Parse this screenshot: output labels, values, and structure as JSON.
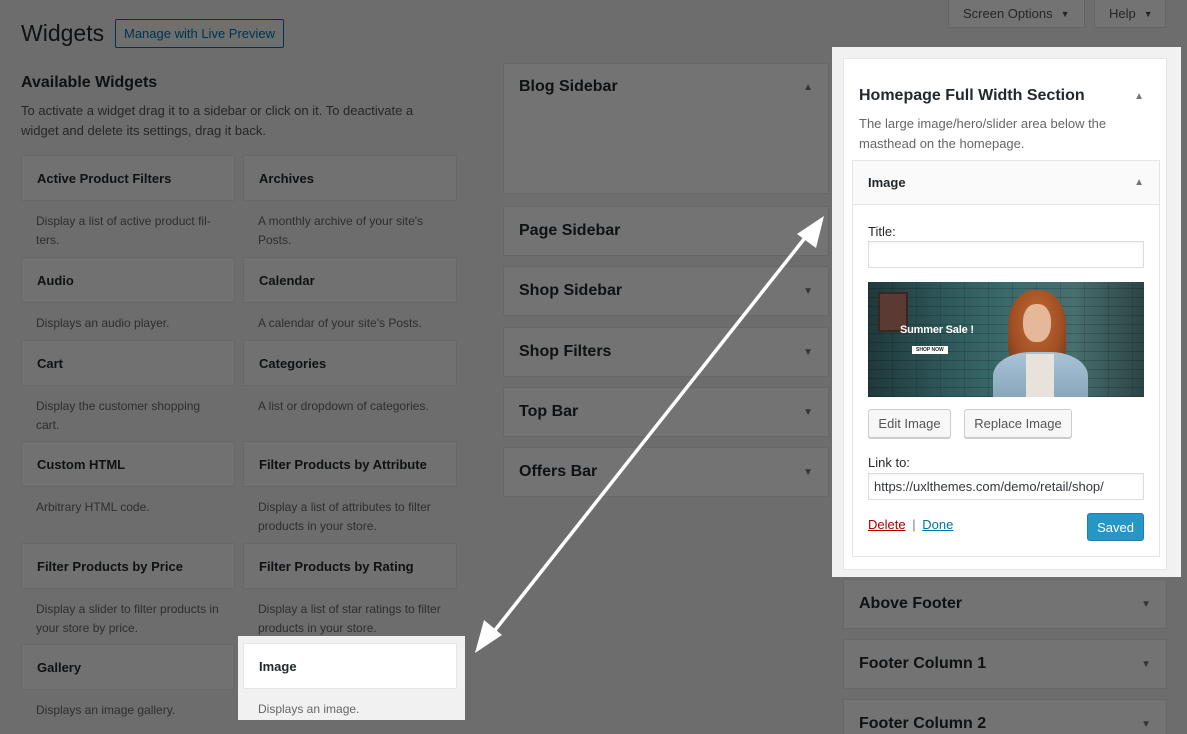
{
  "header": {
    "screen_options": "Screen Options",
    "help": "Help",
    "page_title": "Widgets",
    "live_preview": "Manage with Live Preview"
  },
  "available": {
    "title": "Available Widgets",
    "description": "To activate a widget drag it to a sidebar or click on it. To deactivate a widget and delete its settings, drag it back.",
    "widgets": [
      {
        "name": "Active Product Filters",
        "desc": "Display a list of active product fil-ters."
      },
      {
        "name": "Archives",
        "desc": "A monthly archive of your site's Posts."
      },
      {
        "name": "Audio",
        "desc": "Displays an audio player."
      },
      {
        "name": "Calendar",
        "desc": "A calendar of your site's Posts."
      },
      {
        "name": "Cart",
        "desc": "Display the customer shopping cart."
      },
      {
        "name": "Categories",
        "desc": "A list or dropdown of categories."
      },
      {
        "name": "Custom HTML",
        "desc": "Arbitrary HTML code."
      },
      {
        "name": "Filter Products by Attribute",
        "desc": "Display a list of attributes to filter products in your store."
      },
      {
        "name": "Filter Products by Price",
        "desc": "Display a slider to filter products in your store by price."
      },
      {
        "name": "Filter Products by Rating",
        "desc": "Display a list of star ratings to filter products in your store."
      },
      {
        "name": "Gallery",
        "desc": "Displays an image gallery."
      },
      {
        "name": "Image",
        "desc": "Displays an image."
      }
    ]
  },
  "sidebars_middle": [
    {
      "name": "Blog Sidebar"
    },
    {
      "name": "Page Sidebar"
    },
    {
      "name": "Shop Sidebar"
    },
    {
      "name": "Shop Filters"
    },
    {
      "name": "Top Bar"
    },
    {
      "name": "Offers Bar"
    }
  ],
  "sidebars_right": [
    {
      "name": "Above Footer"
    },
    {
      "name": "Footer Column 1"
    },
    {
      "name": "Footer Column 2"
    }
  ],
  "homepage_section": {
    "title": "Homepage Full Width Section",
    "description": "The large image/hero/slider area below the masthead on the homepage.",
    "widget": {
      "title": "Image",
      "title_label": "Title:",
      "title_value": "",
      "hero_sale_text": "Summer Sale !",
      "hero_shop_text": "SHOP NOW",
      "edit_image": "Edit Image",
      "replace_image": "Replace Image",
      "link_label": "Link to:",
      "link_value": "https://uxlthemes.com/demo/retail/shop/",
      "delete": "Delete",
      "separator": "|",
      "done": "Done",
      "saved": "Saved"
    }
  }
}
